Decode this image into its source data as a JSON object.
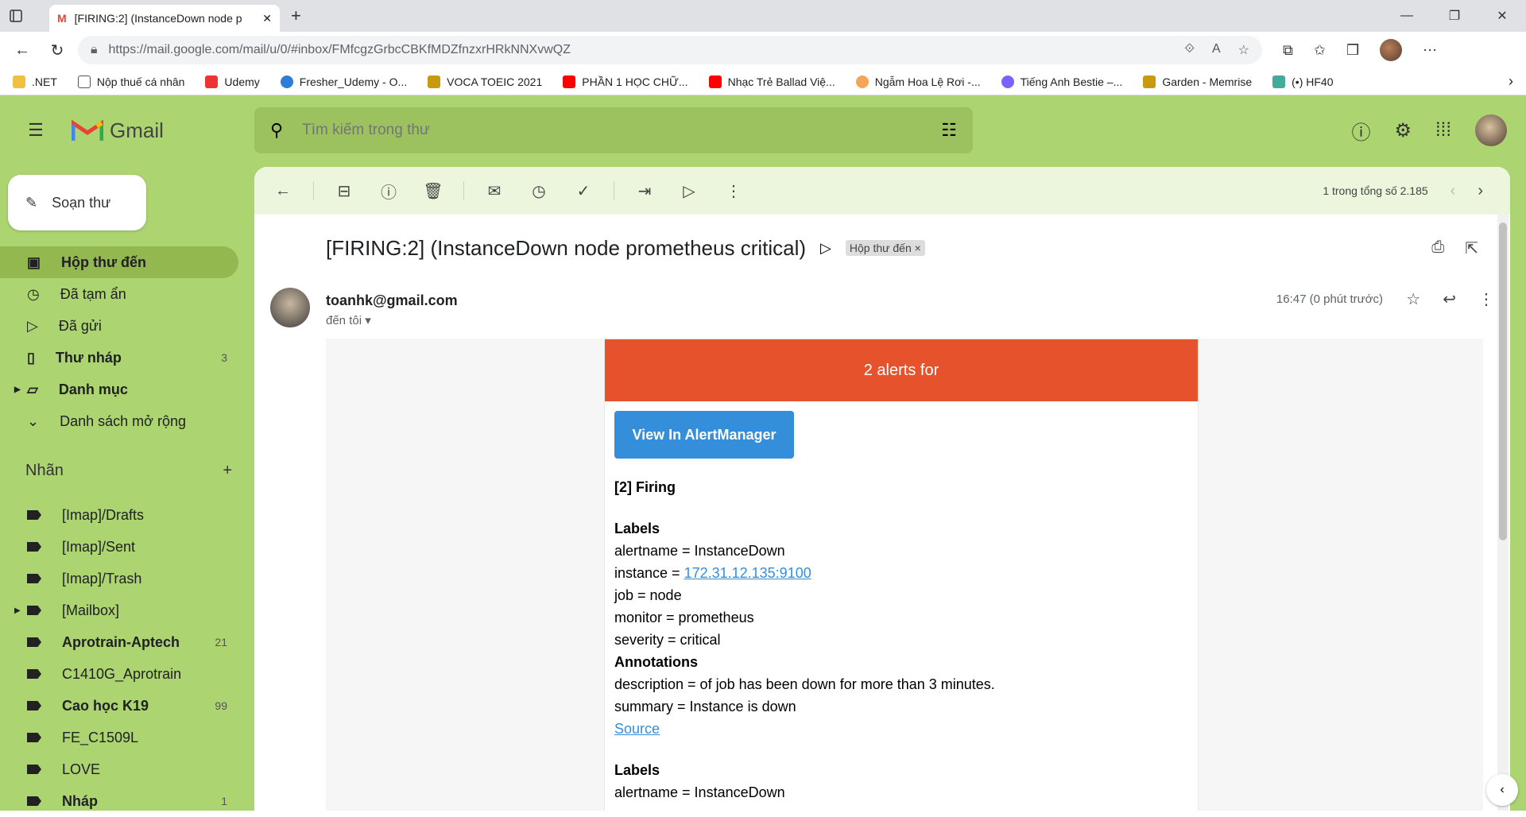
{
  "browser": {
    "tab_title": "[FIRING:2] (InstanceDown node p",
    "url": "https://mail.google.com/mail/u/0/#inbox/FMfcgzGrbcCBKfMDZfnzxrHRkNNXvwQZ",
    "bookmarks": [
      ".NET",
      "Nộp thuế cá nhân",
      "Udemy",
      "Fresher_Udemy - O...",
      "VOCA TOEIC 2021",
      "PHẦN 1 HỌC CHỮ...",
      "Nhạc Trẻ Ballad Việ...",
      "Ngẫm Hoa Lệ Rơi -...",
      "Tiếng Anh Bestie –...",
      "Garden - Memrise",
      "(•) HF40"
    ]
  },
  "gmail": {
    "logo_text": "Gmail",
    "search_placeholder": "Tìm kiếm trong thư",
    "compose_label": "Soạn thư",
    "nav": [
      {
        "label": "Hộp thư đến",
        "count": ""
      },
      {
        "label": "Đã tạm ẩn",
        "count": ""
      },
      {
        "label": "Đã gửi",
        "count": ""
      },
      {
        "label": "Thư nháp",
        "count": "3"
      },
      {
        "label": "Danh mục",
        "count": ""
      },
      {
        "label": "Danh sách mở rộng",
        "count": ""
      }
    ],
    "labels_title": "Nhãn",
    "labels": [
      {
        "label": "[Imap]/Drafts",
        "count": ""
      },
      {
        "label": "[Imap]/Sent",
        "count": ""
      },
      {
        "label": "[Imap]/Trash",
        "count": ""
      },
      {
        "label": "[Mailbox]",
        "count": ""
      },
      {
        "label": "Aprotrain-Aptech",
        "count": "21"
      },
      {
        "label": "C1410G_Aprotrain",
        "count": ""
      },
      {
        "label": "Cao học K19",
        "count": "99"
      },
      {
        "label": "FE_C1509L",
        "count": ""
      },
      {
        "label": "LOVE",
        "count": ""
      },
      {
        "label": "Nháp",
        "count": "1"
      }
    ],
    "pagination": "1 trong tổng số 2.185"
  },
  "email": {
    "subject": "[FIRING:2] (InstanceDown node prometheus critical)",
    "inbox_chip": "Hộp thư đến",
    "sender": "toanhk@gmail.com",
    "to": "đến tôi",
    "time": "16:47 (0 phút trước)",
    "alert_header": "2 alerts for",
    "am_button": "View In AlertManager",
    "firing": "[2] Firing",
    "labels_heading": "Labels",
    "alertname": "alertname = InstanceDown",
    "instance_prefix": "instance = ",
    "instance_link": "172.31.12.135:9100",
    "job": "job = node",
    "monitor": "monitor = prometheus",
    "severity": "severity = critical",
    "annotations_heading": "Annotations",
    "description": "description = of job has been down for more than 3 minutes.",
    "summary": "summary = Instance is down",
    "source": "Source",
    "labels_heading_2": "Labels",
    "alertname_2": "alertname = InstanceDown"
  }
}
